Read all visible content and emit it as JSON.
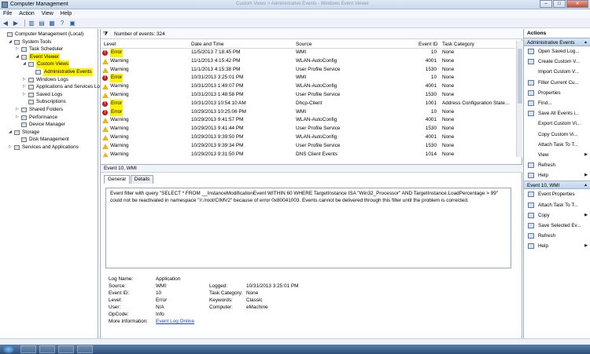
{
  "window": {
    "title": "Computer Management",
    "blurred_title": "Custom Views > Administrative Events - Windows Event Viewer",
    "btn_min": "–",
    "btn_max": "□",
    "btn_close": "✕"
  },
  "menu": [
    "File",
    "Action",
    "View",
    "Help"
  ],
  "toolbar_icons": [
    "back-icon",
    "forward-icon",
    "up-icon",
    "show-hide-tree-icon",
    "properties-icon",
    "help-icon",
    "action-pane-icon"
  ],
  "tree": [
    {
      "label": "Computer Management (Local)",
      "level": 0,
      "arrow": "",
      "hl": false
    },
    {
      "label": "System Tools",
      "level": 1,
      "arrow": "◢",
      "hl": false
    },
    {
      "label": "Task Scheduler",
      "level": 2,
      "arrow": "▷",
      "hl": false
    },
    {
      "label": "Event Viewer",
      "level": 2,
      "arrow": "◢",
      "hl": true
    },
    {
      "label": "Custom Views",
      "level": 3,
      "arrow": "◢",
      "hl": true
    },
    {
      "label": "Administrative Events",
      "level": 4,
      "arrow": "",
      "hl": true
    },
    {
      "label": "Windows Logs",
      "level": 3,
      "arrow": "▷",
      "hl": false
    },
    {
      "label": "Applications and Services Logs",
      "level": 3,
      "arrow": "▷",
      "hl": false
    },
    {
      "label": "Saved Logs",
      "level": 3,
      "arrow": "▷",
      "hl": false
    },
    {
      "label": "Subscriptions",
      "level": 3,
      "arrow": "",
      "hl": false
    },
    {
      "label": "Shared Folders",
      "level": 2,
      "arrow": "▷",
      "hl": false
    },
    {
      "label": "Performance",
      "level": 2,
      "arrow": "▷",
      "hl": false
    },
    {
      "label": "Device Manager",
      "level": 2,
      "arrow": "",
      "hl": false
    },
    {
      "label": "Storage",
      "level": 1,
      "arrow": "◢",
      "hl": false
    },
    {
      "label": "Disk Management",
      "level": 2,
      "arrow": "",
      "hl": false
    },
    {
      "label": "Services and Applications",
      "level": 1,
      "arrow": "▷",
      "hl": false
    }
  ],
  "events": {
    "count_label": "Number of events: 324",
    "columns": [
      "Level",
      "Date and Time",
      "Source",
      "Event ID",
      "Task Category"
    ],
    "rows": [
      {
        "level": "Error",
        "date": "11/5/2013 7:18:45 PM",
        "source": "WMI",
        "id": "10",
        "task": "None",
        "hl": true,
        "sel": false
      },
      {
        "level": "Warning",
        "date": "11/1/2013 4:15:42 PM",
        "source": "WLAN-AutoConfig",
        "id": "4001",
        "task": "None",
        "hl": false,
        "sel": false
      },
      {
        "level": "Warning",
        "date": "11/1/2013 4:15:38 PM",
        "source": "User Profile Service",
        "id": "1530",
        "task": "None",
        "hl": false,
        "sel": false
      },
      {
        "level": "Error",
        "date": "10/31/2013 3:25:01 PM",
        "source": "WMI",
        "id": "10",
        "task": "None",
        "hl": true,
        "sel": true
      },
      {
        "level": "Warning",
        "date": "10/31/2013 1:49:07 PM",
        "source": "WLAN-AutoConfig",
        "id": "4001",
        "task": "None",
        "hl": false,
        "sel": false
      },
      {
        "level": "Warning",
        "date": "10/31/2013 1:48:58 PM",
        "source": "User Profile Service",
        "id": "1530",
        "task": "None",
        "hl": false,
        "sel": false
      },
      {
        "level": "Error",
        "date": "10/31/2013 10:54:10 AM",
        "source": "Dhcp-Client",
        "id": "1001",
        "task": "Address Configuration State...",
        "hl": true,
        "sel": false
      },
      {
        "level": "Error",
        "date": "10/29/2013 10:25:06 PM",
        "source": "WMI",
        "id": "10",
        "task": "None",
        "hl": true,
        "sel": false
      },
      {
        "level": "Warning",
        "date": "10/29/2013 9:41:57 PM",
        "source": "WLAN-AutoConfig",
        "id": "4001",
        "task": "None",
        "hl": false,
        "sel": false
      },
      {
        "level": "Warning",
        "date": "10/29/2013 9:41:44 PM",
        "source": "User Profile Service",
        "id": "1530",
        "task": "None",
        "hl": false,
        "sel": false
      },
      {
        "level": "Warning",
        "date": "10/29/2013 9:39:50 PM",
        "source": "WLAN-AutoConfig",
        "id": "4001",
        "task": "None",
        "hl": false,
        "sel": false
      },
      {
        "level": "Warning",
        "date": "10/29/2013 9:39:34 PM",
        "source": "User Profile Service",
        "id": "1530",
        "task": "None",
        "hl": false,
        "sel": false
      },
      {
        "level": "Warning",
        "date": "10/29/2013 9:31:50 PM",
        "source": "DNS Client Events",
        "id": "1014",
        "task": "None",
        "hl": false,
        "sel": false
      }
    ]
  },
  "detail": {
    "header": "Event 10, WMI",
    "tabs": [
      "General",
      "Details"
    ],
    "message": "Event filter with query \"SELECT * FROM __InstanceModificationEvent WITHIN 60 WHERE TargetInstance ISA \"Win32_Processor\" AND TargetInstance.LoadPercentage > 99\" could not be reactivated in namespace \"//./root/CIMV2\" because of error 0x80041003. Events cannot be delivered through this filter until the problem is corrected.",
    "props": {
      "log_name_l": "Log Name:",
      "log_name": "Application",
      "source_l": "Source:",
      "source": "WMI",
      "event_id_l": "Event ID:",
      "event_id": "10",
      "level_l": "Level:",
      "level": "Error",
      "user_l": "User:",
      "user": "N/A",
      "opcode_l": "OpCode:",
      "opcode": "Info",
      "more_l": "More Information:",
      "more_link": "Event Log Online",
      "logged_l": "Logged:",
      "logged": "10/31/2013 3:25:01 PM",
      "task_l": "Task Category:",
      "task": "None",
      "keywords_l": "Keywords:",
      "keywords": "Classic",
      "computer_l": "Computer:",
      "computer": "eMachine"
    }
  },
  "actions": {
    "title": "Actions",
    "section1": "Administrative Events",
    "items1": [
      {
        "label": "Open Saved Log...",
        "icon": "open-log-icon",
        "sub": false
      },
      {
        "label": "Create Custom V...",
        "icon": "create-custom-view-icon",
        "sub": false
      },
      {
        "label": "Import Custom V...",
        "icon": "",
        "sub": false
      },
      {
        "label": "Filter Current Cu...",
        "icon": "filter-icon",
        "sub": false
      },
      {
        "label": "Properties",
        "icon": "properties-icon",
        "sub": false
      },
      {
        "label": "Find...",
        "icon": "find-icon",
        "sub": false
      },
      {
        "label": "Save All Events i...",
        "icon": "save-icon",
        "sub": false
      },
      {
        "label": "Export Custom Vi...",
        "icon": "",
        "sub": false
      },
      {
        "label": "Copy Custom Vi...",
        "icon": "",
        "sub": false
      },
      {
        "label": "Attach Task To T...",
        "icon": "",
        "sub": false
      },
      {
        "label": "View",
        "icon": "",
        "sub": true
      },
      {
        "label": "Refresh",
        "icon": "refresh-icon",
        "sub": false
      },
      {
        "label": "Help",
        "icon": "help-icon",
        "sub": true
      }
    ],
    "section2": "Event 10, WMI",
    "items2": [
      {
        "label": "Event Properties",
        "icon": "event-properties-icon",
        "sub": false
      },
      {
        "label": "Attach Task To T...",
        "icon": "attach-task-icon",
        "sub": false
      },
      {
        "label": "Copy",
        "icon": "copy-icon",
        "sub": true
      },
      {
        "label": "Save Selected Ev...",
        "icon": "save-icon",
        "sub": false
      },
      {
        "label": "Refresh",
        "icon": "refresh-icon",
        "sub": false
      },
      {
        "label": "Help",
        "icon": "help-icon",
        "sub": true
      }
    ]
  }
}
